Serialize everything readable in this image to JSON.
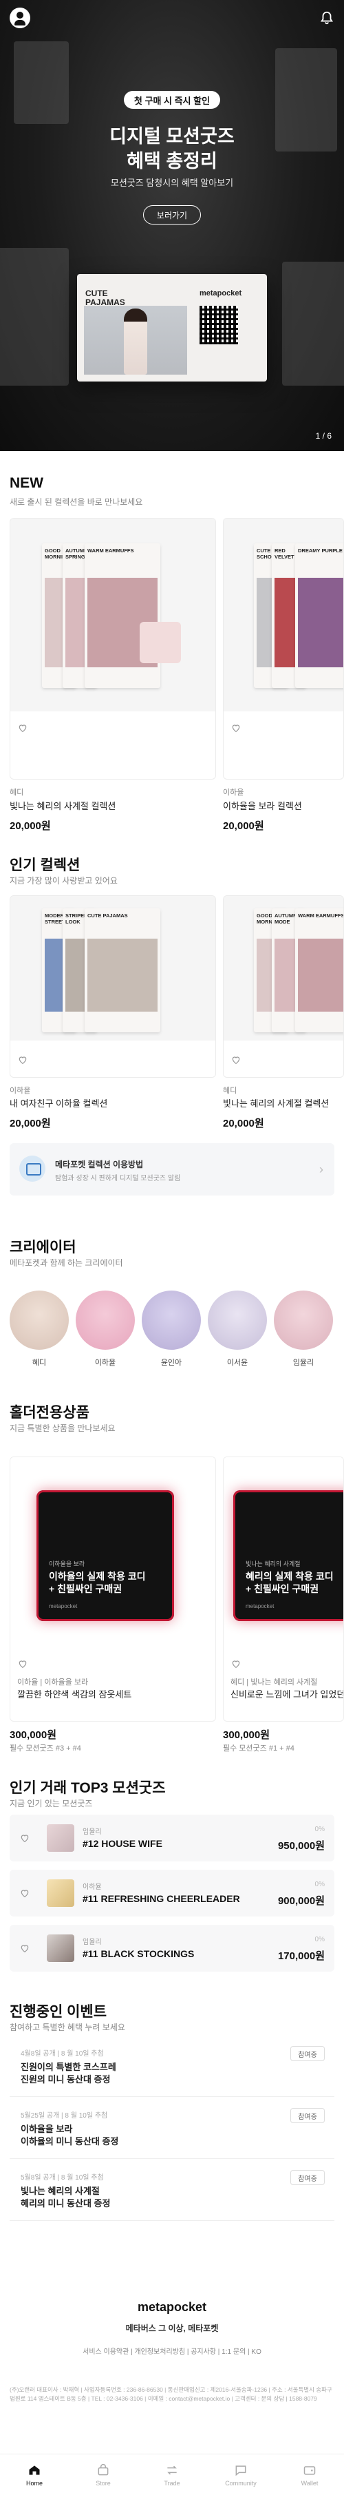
{
  "header": {
    "profile_icon": "profile-icon",
    "bell_icon": "bell-icon"
  },
  "hero": {
    "badge": "첫 구매 시 즉시 할인",
    "title_line1": "디지털 모션굿즈",
    "title_line2": "혜택 총정리",
    "subtitle": "모션굿즈 담청시의 혜택 알아보기",
    "button": "보러가기",
    "ticket_title_1": "CUTE",
    "ticket_title_2": "PAJAMAS",
    "ticket_brand": "metapocket",
    "pager": "1 / 6"
  },
  "new_section": {
    "title": "NEW",
    "subtitle": "새로 출시 된 컬렉션을 바로 만나보세요",
    "items": [
      {
        "creator": "혜디",
        "title": "빛나는 혜리의 사계절 컬렉션",
        "price": "20,000원",
        "card_labels": [
          "GOOD MORNING",
          "AUTUMN SPRING",
          "WARM EARMUFFS"
        ],
        "accent": "#c9a1a6"
      },
      {
        "creator": "이하율",
        "title": "이하율을 보라 컬렉션",
        "price": "20,000원",
        "card_labels": [
          "CUTE SCHOOL",
          "RED VELVET",
          "DREAMY PURPLE"
        ],
        "accent": "#b94a4f"
      }
    ]
  },
  "popular_section": {
    "title": "인기 컬렉션",
    "subtitle": "지금 가장 많이 사랑받고 있어요",
    "items": [
      {
        "creator": "이하율",
        "title": "내 여자친구 이하율 컬렉션",
        "price": "20,000원",
        "card_labels": [
          "MODERN STREET",
          "STRIPED LOOK",
          "CUTE PAJAMAS"
        ]
      },
      {
        "creator": "혜디",
        "title": "빛나는 혜리의 사계절 컬렉션",
        "price": "20,000원",
        "card_labels": [
          "GOOD MORNING",
          "AUTUMN MODE",
          "WARM EARMUFFS"
        ]
      }
    ]
  },
  "guide": {
    "title": "메타포켓 컬렉션 이용방법",
    "subtitle": "탐험과 성장 시 편하게 디지털 모션굿즈 알림"
  },
  "creators_section": {
    "title": "크리에이터",
    "subtitle": "메타포켓과 함께 하는 크리에이터",
    "creators": [
      "혜디",
      "이하율",
      "윤인아",
      "이서윤",
      "임율리"
    ]
  },
  "goods_section": {
    "title": "홀더전용상품",
    "subtitle": "지금 특별한 상품을 만나보세요",
    "items": [
      {
        "creator": "이하율 | 이하율을 보라",
        "title": "깔끔한 하얀색 색감의 잠옷세트",
        "price": "300,000원",
        "req": "필수 모션굿즈 #3 + #4",
        "banner_small": "이하율을 보라",
        "banner_1": "이하율의 실제 착용 코디",
        "banner_2": "+ 친필싸인 구매권"
      },
      {
        "creator": "혜디 | 빛나는 혜리의 사계절",
        "title": "신비로운 느낌에 그녀가 입었던 원피스",
        "price": "300,000원",
        "req": "필수 모션굿즈 #1 + #4",
        "banner_small": "빛나는 혜리의 사계절",
        "banner_1": "혜리의 실제 착용 코디",
        "banner_2": "+ 친필싸인 구매권"
      }
    ]
  },
  "top3_section": {
    "title": "인기 거래 TOP3 모션굿즈",
    "subtitle": "지금 인기 있는 모션굿즈",
    "items": [
      {
        "creator": "임율리",
        "name": "#12 HOUSE WIFE",
        "pct": "0%",
        "price": "950,000원"
      },
      {
        "creator": "이하율",
        "name": "#11 REFRESHING CHEERLEADER",
        "pct": "0%",
        "price": "900,000원"
      },
      {
        "creator": "임율리",
        "name": "#11 BLACK STOCKINGS",
        "pct": "0%",
        "price": "170,000원"
      }
    ]
  },
  "events_section": {
    "title": "진행중인 이벤트",
    "subtitle": "참여하고 특별한 혜택 누려 보세요",
    "items": [
      {
        "date": "4월8일 공개 | 8 월 10일 추첨",
        "line1": "진원이의 특별한 코스프레",
        "line2": "진원의 미니 동산대 증정",
        "tag": "참여중"
      },
      {
        "date": "5월25일 공개 | 8 월 10일 추첨",
        "line1": "이하율을 보라",
        "line2": "이하율의 미니 동산대 증정",
        "tag": "참여중"
      },
      {
        "date": "5월8일 공개 | 8 월 10일 추첨",
        "line1": "빛나는 혜리의 사계절",
        "line2": "혜리의 미니 동산대 증정",
        "tag": "참여중"
      }
    ]
  },
  "footer": {
    "logo": "metapocket",
    "tagline": "메타버스 그 이상, 메타포켓",
    "links": "서비스 이용약관 | 개인정보처리방침 | 공지사항 | 1:1 문의 | KO",
    "info": "(주)오랜러 대표이사 : 박재혁 | 사업자등록번호 : 236-86-86530 | 통신판매업신고 : 제2016-서울송파-1236 | 주소 : 서울특별시 송파구 법원로 114 엠스테이트 B동 5층 | TEL : 02-3436-3106 | 이메일 : contact@metapocket.io | 고객센터 : 문의 상담 | 1588-8079"
  },
  "tabbar": {
    "tabs": [
      "Home",
      "Store",
      "Trade",
      "Community",
      "Wallet"
    ]
  }
}
